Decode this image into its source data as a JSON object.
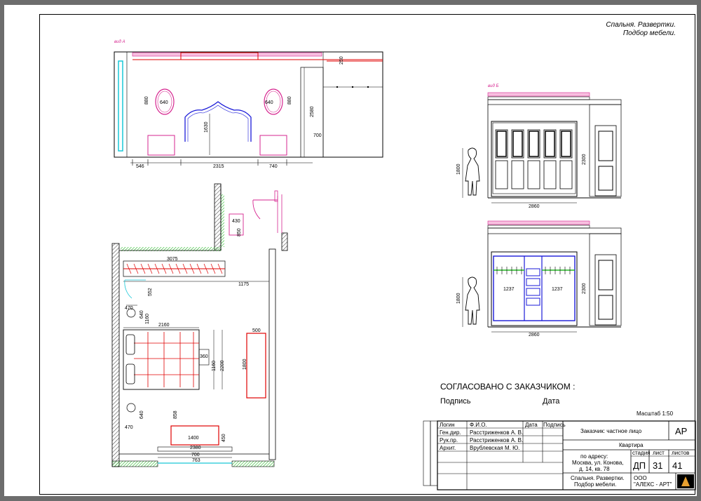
{
  "sheet_title": {
    "line1": "Спальня. Развертки.",
    "line2": "Подбор мебели."
  },
  "views": {
    "view_a": "вид А",
    "view_b": "вид Б"
  },
  "elevation_a_dims": {
    "h_250": "250",
    "h_2580": "2580",
    "h_700": "700",
    "mirror_w": "640",
    "mirror_h": "880",
    "bed_h": "1630",
    "d_546": "546",
    "d_2315": "2315",
    "d_740": "740"
  },
  "elevation_b_dims": {
    "person_h": "1800",
    "wardrobe_w": "2860",
    "wardrobe_h": "2300",
    "inner_1": "1237",
    "inner_2": "1237"
  },
  "plan_dims": {
    "d_430": "430",
    "d_850": "850",
    "d_3075": "3075",
    "d_1175": "1175",
    "d_552": "552",
    "d_470a": "470",
    "d_640a": "640",
    "d_1160": "1160",
    "d_2160": "2160",
    "d_360": "360",
    "d_1160b": "1160",
    "d_2200": "2200",
    "d_500": "500",
    "d_1800": "1800",
    "d_858": "858",
    "d_640b": "640",
    "d_470b": "470",
    "d_1400": "1400",
    "d_450": "450",
    "d_2380": "2380",
    "d_700": "700",
    "d_763": "763"
  },
  "approval": {
    "heading": "СОГЛАСОВАНО С ЗАКАЗЧИКОМ :",
    "signature": "Подпись",
    "date": "Дата"
  },
  "scale": "Масштаб  1:50",
  "title_block": {
    "hdr": {
      "role": "Логин",
      "fio": "Ф.И.О.",
      "date": "Дата",
      "sign": "Подпись"
    },
    "rows": [
      {
        "role": "Ген.дир.",
        "name": "Расстриженков А. В."
      },
      {
        "role": "Рук.пр.",
        "name": "Расстриженков А. В."
      },
      {
        "role": "Архит.",
        "name": "Врублевская М. Ю."
      }
    ],
    "customer": "Заказчик:  частное лицо",
    "stage_code": "АР",
    "object": "Квартира",
    "address": [
      "по адресу:",
      "Москва, ул. Конова,",
      "д. 14, кв. 78"
    ],
    "stage_label": "стадия",
    "sheet_label": "лист",
    "sheets_label": "листов",
    "stage": "ДП",
    "sheet": "31",
    "sheets": "41",
    "drawing_name": [
      "Спальня. Развертки.",
      "Подбор мебели."
    ],
    "company": [
      "ООО",
      "\"АЛЕКС - АРТ\""
    ]
  },
  "colors": {
    "pink": "#d6248f",
    "red": "#e00000",
    "green": "#22b822",
    "blue": "#1a1ad8",
    "cyan": "#19c8d8"
  }
}
